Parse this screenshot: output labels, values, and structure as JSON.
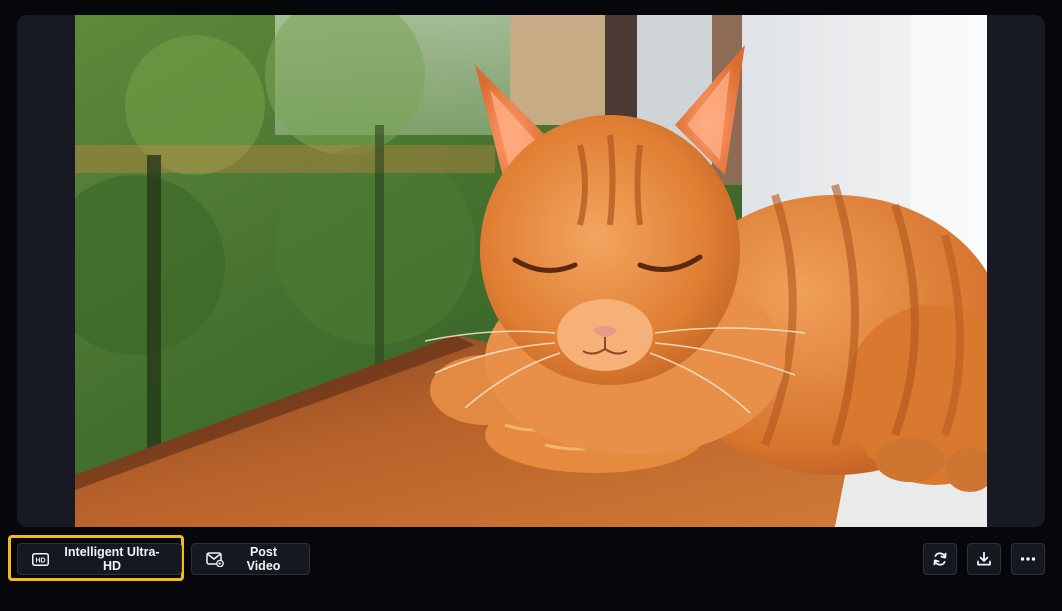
{
  "preview": {
    "image_alt": "orange tabby cat sleeping on a wooden windowsill"
  },
  "toolbar": {
    "ultra_hd_label": "Intelligent Ultra-HD",
    "post_video_label": "Post Video",
    "hd_badge": "HD"
  },
  "icons": {
    "ultra_hd": "hd-icon",
    "post_video": "post-video-icon",
    "refresh": "refresh-icon",
    "download": "download-icon",
    "more": "more-icon"
  },
  "colors": {
    "background": "#05070b",
    "panel": "#171a22",
    "button": "#15181f",
    "highlight": "#f7b91a"
  }
}
